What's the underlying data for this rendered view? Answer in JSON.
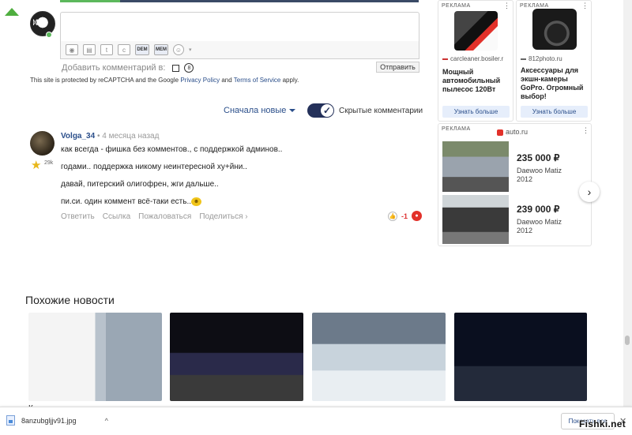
{
  "comment_form": {
    "add_comment_label": "Добавить комментарий в:",
    "send_label": "Отправить",
    "tool_dem": "DEM",
    "tool_mem": "MEM",
    "question_mark": "8"
  },
  "recaptcha": {
    "prefix": "This site is protected by reCAPTCHA and the Google",
    "privacy": "Privacy Policy",
    "and": "and",
    "terms": "Terms of Service",
    "suffix": "apply."
  },
  "sort": {
    "label": "Сначала новые",
    "hidden_comments_label": "Скрытые комментарии",
    "hidden_toggle_on": true
  },
  "comment": {
    "author": "Volga_34",
    "time": "• 4 месяца назад",
    "badge_count": "29k",
    "lines": [
      "как всегда - фишка без комментов., с поддержкой админов..",
      "годами.. поддержка никому неинтересной ху+йни..",
      "давай, питерский олигофрен, жги дальше..",
      "пи.си. один коммент всё-таки есть.."
    ],
    "actions": [
      "Ответить",
      "Ссылка",
      "Пожаловаться",
      "Поделиться ›"
    ],
    "score": "-1"
  },
  "ads": {
    "label": "РЕКЛАМА",
    "ad1": {
      "source": "carcleaner.bosiler.r",
      "title": "Мощный автомобильный пылесос 120Вт",
      "button": "Узнать больше"
    },
    "ad2": {
      "source": "812photo.ru",
      "title": "Аксессуары для экшн-камеры GoPro. Огромный выбор!",
      "button": "Узнать больше"
    },
    "ad3": {
      "source": "auto.ru",
      "cars": [
        {
          "price": "235 000 ₽",
          "model": "Daewoo Matiz",
          "year": "2012"
        },
        {
          "price": "239 000 ₽",
          "model": "Daewoo Matiz",
          "year": "2012"
        }
      ]
    }
  },
  "similar": {
    "title": "Похожие новости",
    "cut_text": "К"
  },
  "download_bar": {
    "filename": "8anzubgljjv91.jpg",
    "show_all": "Показать все",
    "close": "✕"
  },
  "watermark": "Fishki.net",
  "colors": {
    "accent": "#2a4e8a",
    "green": "#5cb85c",
    "toggle": "#24315a",
    "negative": "#e2312a"
  }
}
